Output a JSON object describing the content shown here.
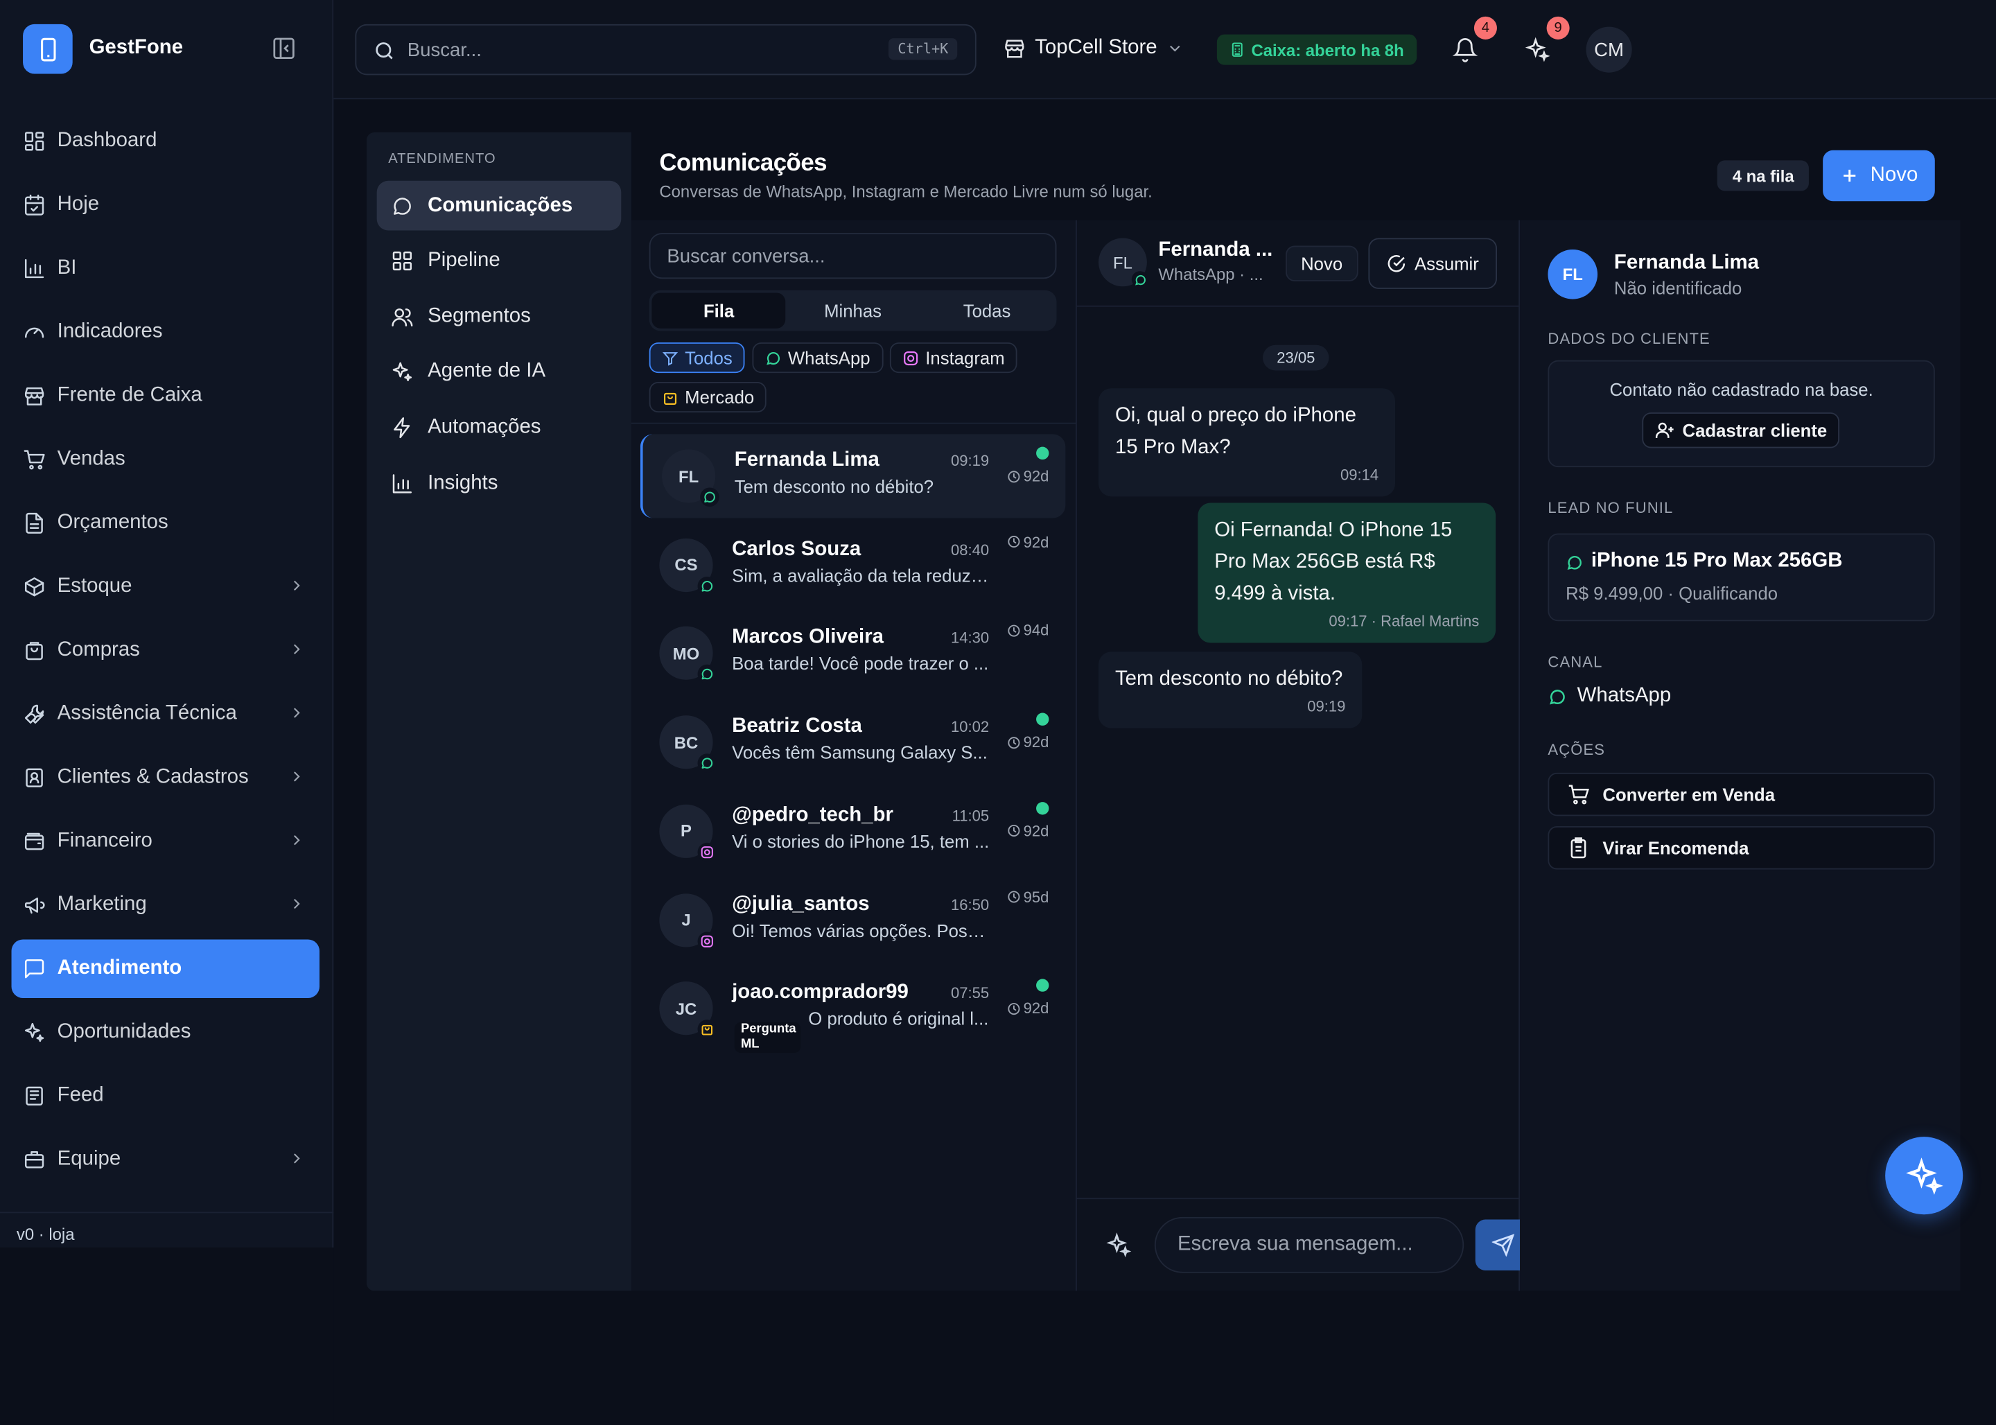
{
  "app": {
    "name": "GestFone",
    "version": "v0 · loja"
  },
  "sidebar": {
    "items": [
      {
        "label": "Dashboard",
        "icon": "dashboard-icon"
      },
      {
        "label": "Hoje",
        "icon": "calendar-icon"
      },
      {
        "label": "BI",
        "icon": "bar-chart-icon"
      },
      {
        "label": "Indicadores",
        "icon": "gauge-icon"
      },
      {
        "label": "Frente de Caixa",
        "icon": "store-icon"
      },
      {
        "label": "Vendas",
        "icon": "cart-icon"
      },
      {
        "label": "Orçamentos",
        "icon": "file-icon"
      },
      {
        "label": "Estoque",
        "icon": "box-icon",
        "expandable": true
      },
      {
        "label": "Compras",
        "icon": "bag-icon",
        "expandable": true
      },
      {
        "label": "Assistência Técnica",
        "icon": "wrench-icon",
        "expandable": true
      },
      {
        "label": "Clientes & Cadastros",
        "icon": "contact-icon",
        "expandable": true
      },
      {
        "label": "Financeiro",
        "icon": "wallet-icon",
        "expandable": true
      },
      {
        "label": "Marketing",
        "icon": "megaphone-icon",
        "expandable": true
      },
      {
        "label": "Atendimento",
        "icon": "message-icon",
        "active": true
      },
      {
        "label": "Oportunidades",
        "icon": "sparkles-icon"
      },
      {
        "label": "Feed",
        "icon": "newspaper-icon"
      },
      {
        "label": "Equipe",
        "icon": "briefcase-icon",
        "expandable": true
      }
    ]
  },
  "topbar": {
    "search_placeholder": "Buscar...",
    "shortcut": "Ctrl+K",
    "store": "TopCell Store",
    "caixa_status": "Caixa: aberto ha 8h",
    "notifications_count": "4",
    "ai_count": "9",
    "user_initials": "CM"
  },
  "subnav": {
    "heading": "ATENDIMENTO",
    "items": [
      "Comunicações",
      "Pipeline",
      "Segmentos",
      "Agente de IA",
      "Automações",
      "Insights"
    ]
  },
  "page": {
    "title": "Comunicações",
    "subtitle": "Conversas de WhatsApp, Instagram e Mercado Livre num só lugar.",
    "queue": "4 na fila",
    "new_button": "Novo"
  },
  "list": {
    "search_placeholder": "Buscar conversa...",
    "tabs": [
      "Fila",
      "Minhas",
      "Todas"
    ],
    "filters": [
      "Todos",
      "WhatsApp",
      "Instagram",
      "Mercado"
    ],
    "conversations": [
      {
        "initials": "FL",
        "name": "Fernanda Lima",
        "time": "09:19",
        "preview": "Tem desconto no débito?",
        "age": "92d",
        "unread": true,
        "channel": "whatsapp"
      },
      {
        "initials": "CS",
        "name": "Carlos Souza",
        "time": "08:40",
        "preview": "Sim, a avaliação da tela reduz ...",
        "age": "92d",
        "unread": false,
        "channel": "whatsapp"
      },
      {
        "initials": "MO",
        "name": "Marcos Oliveira",
        "time": "14:30",
        "preview": "Boa tarde! Você pode trazer o ...",
        "age": "94d",
        "unread": false,
        "channel": "whatsapp"
      },
      {
        "initials": "BC",
        "name": "Beatriz Costa",
        "time": "10:02",
        "preview": "Vocês têm Samsung Galaxy S...",
        "age": "92d",
        "unread": true,
        "channel": "whatsapp"
      },
      {
        "initials": "P",
        "name": "@pedro_tech_br",
        "time": "11:05",
        "preview": "Vi o stories do iPhone 15, tem ...",
        "age": "92d",
        "unread": true,
        "channel": "instagram"
      },
      {
        "initials": "J",
        "name": "@julia_santos",
        "time": "16:50",
        "preview": "Oi! Temos várias opções. Poss...",
        "age": "95d",
        "unread": false,
        "channel": "instagram"
      },
      {
        "initials": "JC",
        "name": "joao.comprador99",
        "time": "07:55",
        "preview": "O produto é original l...",
        "age": "92d",
        "unread": true,
        "channel": "mercado",
        "tag_line1": "Pergunta",
        "tag_line2": "ML"
      }
    ]
  },
  "chat": {
    "contact_initials": "FL",
    "contact_name": "Fernanda ...",
    "contact_sub": "WhatsApp · ...",
    "status": "Novo",
    "assign_button": "Assumir",
    "date": "23/05",
    "messages": [
      {
        "dir": "in",
        "text": "Oi, qual o preço do iPhone 15 Pro Max?",
        "time": "09:14"
      },
      {
        "dir": "out",
        "text": "Oi Fernanda! O iPhone 15 Pro Max 256GB está R$ 9.499 à vista.",
        "time": "09:17 · Rafael Martins"
      },
      {
        "dir": "in",
        "text": "Tem desconto no débito?",
        "time": "09:19"
      }
    ],
    "composer_placeholder": "Escreva sua mensagem..."
  },
  "details": {
    "initials": "FL",
    "name": "Fernanda Lima",
    "status": "Não identificado",
    "client_heading": "DADOS DO CLIENTE",
    "client_note": "Contato não cadastrado na base.",
    "register_button": "Cadastrar cliente",
    "lead_heading": "LEAD NO FUNIL",
    "lead_product": "iPhone 15 Pro Max 256GB",
    "lead_info": "R$ 9.499,00 · Qualificando",
    "channel_heading": "CANAL",
    "channel": "WhatsApp",
    "actions_heading": "AÇÕES",
    "actions": [
      "Converter em Venda",
      "Virar Encomenda"
    ]
  },
  "colors": {
    "accent": "#3b82f6",
    "success": "#34d399",
    "badge": "#f87171",
    "outgoing": "#123a33"
  }
}
